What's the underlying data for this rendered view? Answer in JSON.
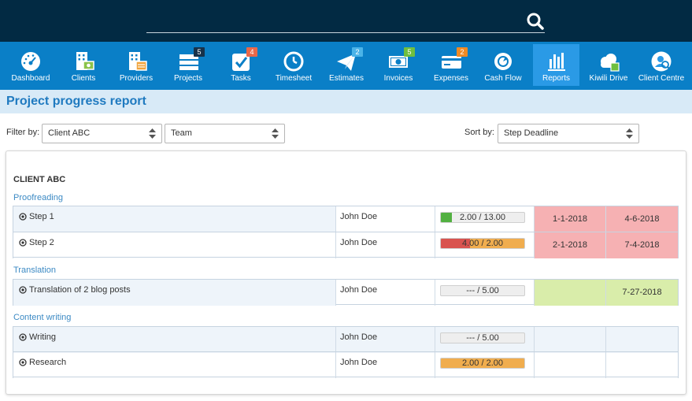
{
  "colors": {
    "top_bar": "#022a43",
    "nav_bar": "#0a7fc7",
    "nav_active": "#2a9ae6",
    "title_bg": "#d8eaf7",
    "title_text": "#1f7ac0",
    "overdue": "#f6b1b3",
    "on_time": "#d9edaa",
    "bar_green": "#52b041",
    "bar_red": "#d9534f",
    "bar_orange": "#f0ad4e"
  },
  "search": {
    "icon": "search-icon"
  },
  "nav": {
    "items": [
      {
        "label": "Dashboard",
        "icon": "dashboard-icon",
        "badge": ""
      },
      {
        "label": "Clients",
        "icon": "clients-icon",
        "badge": ""
      },
      {
        "label": "Providers",
        "icon": "providers-icon",
        "badge": ""
      },
      {
        "label": "Projects",
        "icon": "projects-icon",
        "badge": "5"
      },
      {
        "label": "Tasks",
        "icon": "tasks-icon",
        "badge": "4"
      },
      {
        "label": "Timesheet",
        "icon": "timesheet-icon",
        "badge": ""
      },
      {
        "label": "Estimates",
        "icon": "estimates-icon",
        "badge": "2"
      },
      {
        "label": "Invoices",
        "icon": "invoices-icon",
        "badge": "5"
      },
      {
        "label": "Expenses",
        "icon": "expenses-icon",
        "badge": "2"
      },
      {
        "label": "Cash Flow",
        "icon": "cash-flow-icon",
        "badge": ""
      },
      {
        "label": "Reports",
        "icon": "reports-icon",
        "badge": "",
        "active": true
      },
      {
        "label": "Kiwili Drive",
        "icon": "cloud-drive-icon",
        "badge": ""
      },
      {
        "label": "Client Centre",
        "icon": "client-centre-icon",
        "badge": ""
      }
    ]
  },
  "page": {
    "title": "Project progress report"
  },
  "filters": {
    "filter_label": "Filter by:",
    "client_value": "Client ABC",
    "team_value": "Team",
    "sort_label": "Sort by:",
    "sort_value": "Step Deadline"
  },
  "report": {
    "client": "CLIENT ABC",
    "groups": [
      {
        "name": "Proofreading",
        "steps": [
          {
            "name": "Step 1",
            "user": "John Doe",
            "progress": "2.00 / 13.00",
            "done": 2.0,
            "total": 13.0,
            "bar_color": "green",
            "start": "1-1-2018",
            "end": "4-6-2018",
            "status": "overdue"
          },
          {
            "name": "Step 2",
            "user": "John Doe",
            "progress": "4.00 / 2.00",
            "done": 4.0,
            "total": 2.0,
            "bar_color": "red-orange",
            "start": "2-1-2018",
            "end": "7-4-2018",
            "status": "overdue"
          }
        ]
      },
      {
        "name": "Translation",
        "steps": [
          {
            "name": "Translation of 2 blog posts",
            "user": "John Doe",
            "progress": "--- / 5.00",
            "done": 0,
            "total": 5.0,
            "bar_color": "none",
            "start": "",
            "end": "7-27-2018",
            "status": "on_time"
          }
        ]
      },
      {
        "name": "Content writing",
        "steps": [
          {
            "name": "Writing",
            "user": "John Doe",
            "progress": "--- / 5.00",
            "done": 0,
            "total": 5.0,
            "bar_color": "none",
            "start": "",
            "end": "",
            "status": "none"
          },
          {
            "name": "Research",
            "user": "John Doe",
            "progress": "2.00 / 2.00",
            "done": 2.0,
            "total": 2.0,
            "bar_color": "orange",
            "start": "",
            "end": "",
            "status": "none"
          }
        ]
      }
    ]
  }
}
